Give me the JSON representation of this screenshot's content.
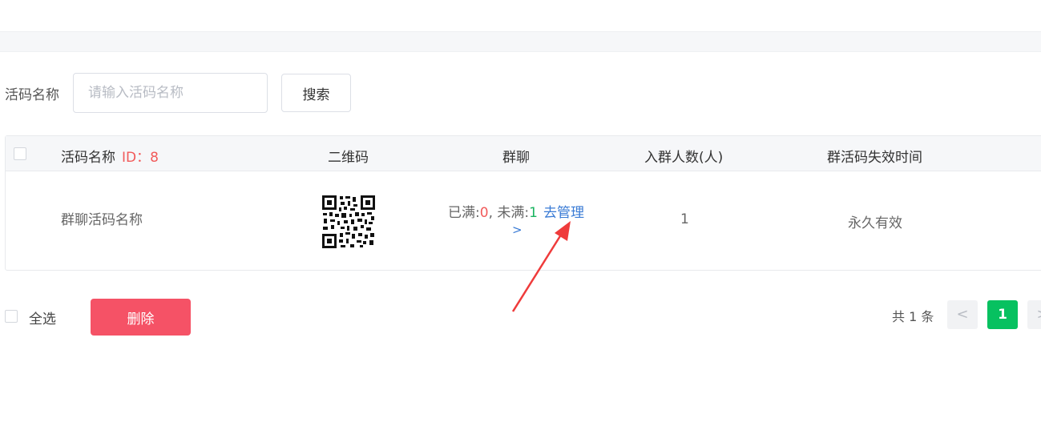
{
  "search": {
    "label": "活码名称",
    "placeholder": "请输入活码名称",
    "value": "",
    "button_label": "搜索"
  },
  "table": {
    "headers": {
      "name": "活码名称",
      "id": "ID：8",
      "qrcode": "二维码",
      "group_chat": "群聊",
      "join_count": "入群人数(人)",
      "expire_time": "群活码失效时间"
    },
    "rows": [
      {
        "name": "群聊活码名称",
        "qrcode_icon": "qr-code-icon",
        "full_label": "已满:",
        "full_count": "0",
        "sep": ", ",
        "not_full_label": "未满:",
        "not_full_count": "1",
        "manage_link": "去管理",
        "manage_arrow": ">",
        "join_count": "1",
        "expire_time": "永久有效"
      }
    ]
  },
  "footer": {
    "select_all_label": "全选",
    "delete_label": "删除",
    "total_text": "共 1 条",
    "prev_label": "<",
    "current_page": "1",
    "next_label": ">"
  },
  "colors": {
    "accent_green": "#07c160",
    "delete_red": "#f55266",
    "link_blue": "#3a7bd5",
    "annotation_arrow": "#ef3b3b"
  }
}
